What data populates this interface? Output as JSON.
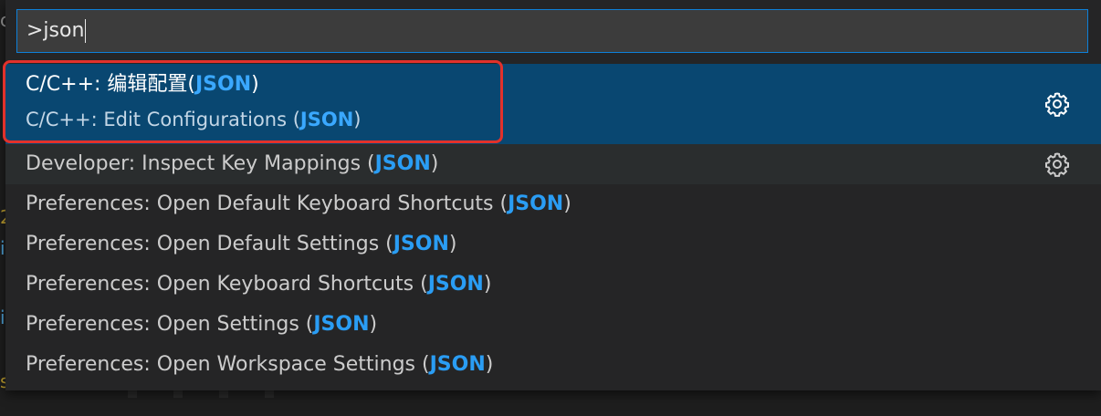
{
  "search": {
    "query": ">json"
  },
  "items": [
    {
      "primary_prefix": "C/C++: 编辑配置(",
      "match": "JSON",
      "primary_suffix": ")",
      "secondary_prefix": "C/C++: Edit Configurations (",
      "secondary_match": "JSON",
      "secondary_suffix": ")",
      "icon": "gear-icon",
      "state": "selected"
    },
    {
      "prefix": "Developer: Inspect Key Mappings (",
      "match": "JSON",
      "suffix": ")",
      "icon": "gear-icon",
      "state": "hover"
    },
    {
      "prefix": "Preferences: Open Default Keyboard Shortcuts (",
      "match": "JSON",
      "suffix": ")"
    },
    {
      "prefix": "Preferences: Open Default Settings (",
      "match": "JSON",
      "suffix": ")"
    },
    {
      "prefix": "Preferences: Open Keyboard Shortcuts (",
      "match": "JSON",
      "suffix": ")"
    },
    {
      "prefix": "Preferences: Open Settings (",
      "match": "JSON",
      "suffix": ")"
    },
    {
      "prefix": "Preferences: Open Workspace Settings (",
      "match": "JSON",
      "suffix": ")"
    }
  ],
  "colors": {
    "selected_background": "#094771",
    "match_highlight": "#2a9df4",
    "input_border": "#0e80d8",
    "annotation_box": "#e2312b"
  }
}
